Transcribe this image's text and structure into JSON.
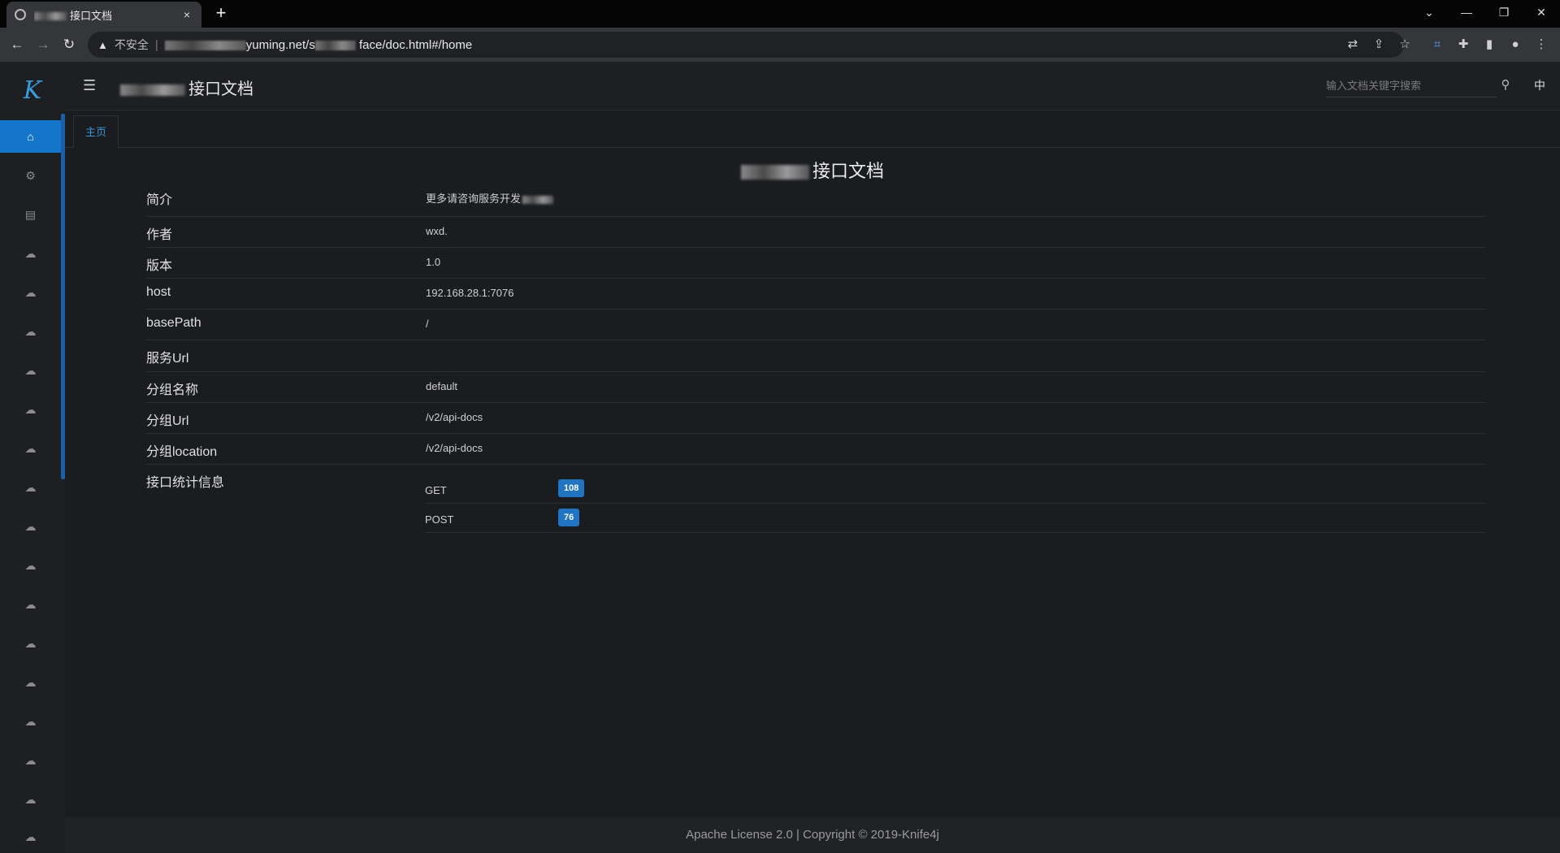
{
  "browser": {
    "tab_title": "接口文档",
    "new_tab": "+",
    "tab_close": "×",
    "insecure_label": "不安全",
    "url_visible_a": "yuming.net/s",
    "url_visible_b": "face/doc.html#/home"
  },
  "window_controls": {
    "minimize": "—",
    "restore": "❐",
    "close": "✕",
    "dropdown": "⌄"
  },
  "app": {
    "logo": "K",
    "doc_title": "接口文档",
    "search_placeholder": "输入文档关键字搜索",
    "lang": "中"
  },
  "tabs": [
    {
      "label": "主页"
    }
  ],
  "main": {
    "title": "接口文档",
    "rows": [
      {
        "label": "简介",
        "value": "更多请咨询服务开发"
      },
      {
        "label": "作者",
        "value": "wxd."
      },
      {
        "label": "版本",
        "value": "1.0"
      },
      {
        "label": "host",
        "value": "192.168.28.1:7076"
      },
      {
        "label": "basePath",
        "value": "/"
      },
      {
        "label": "服务Url",
        "value": ""
      },
      {
        "label": "分组名称",
        "value": "default"
      },
      {
        "label": "分组Url",
        "value": "/v2/api-docs"
      },
      {
        "label": "分组location",
        "value": "/v2/api-docs"
      },
      {
        "label": "接口统计信息",
        "value": ""
      }
    ],
    "stats": [
      {
        "method": "GET",
        "count": "108"
      },
      {
        "method": "POST",
        "count": "76"
      }
    ]
  },
  "footer": {
    "text": "Apache License 2.0 | Copyright © 2019-Knife4j"
  },
  "colors": {
    "accent": "#1476c9",
    "badge": "#1f74c4",
    "background": "#1a1c1f"
  }
}
